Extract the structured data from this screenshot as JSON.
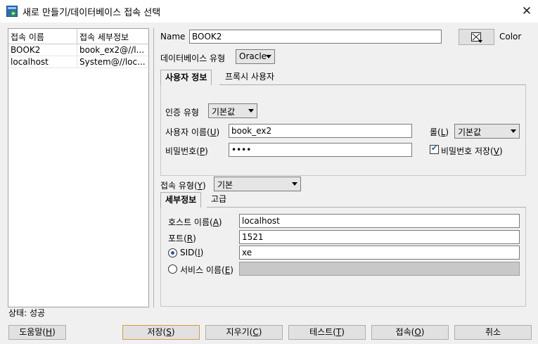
{
  "window": {
    "title": "새로 만들기/데이터베이스 접속 선택",
    "close_glyph": "✕"
  },
  "connections": {
    "headers": [
      "접속 이름",
      "접속 세부정보"
    ],
    "rows": [
      {
        "name": "BOOK2",
        "details": "book_ex2@//l..."
      },
      {
        "name": "localhost",
        "details": "System@//loc..."
      }
    ]
  },
  "status": "상태: 성공",
  "form": {
    "name_label": "Name",
    "name_value": "BOOK2",
    "color_label": "Color",
    "dbtype_label": "데이터베이스 유형",
    "dbtype_value": "Oracle",
    "tabs_main": [
      "사용자 정보",
      "프록시 사용자"
    ],
    "auth_label": "인증 유형",
    "auth_value": "기본값",
    "username_label": "사용자 이름(",
    "username_key": "U",
    "username_value": "book_ex2",
    "role_label": "롤(",
    "role_key": "L",
    "role_value": "기본값",
    "password_label": "비밀번호(",
    "password_key": "P",
    "password_value": "••••",
    "save_pw_label": "비밀번호 저장(",
    "save_pw_key": "V",
    "save_pw_checked": true,
    "conn_type_label": "접속 유형(",
    "conn_type_key": "Y",
    "conn_type_value": "기본",
    "tabs_conn": [
      "세부정보",
      "고급"
    ],
    "host_label": "호스트 이름(",
    "host_key": "A",
    "host_value": "localhost",
    "port_label": "포트(",
    "port_key": "R",
    "port_value": "1521",
    "sid_label": "SID(",
    "sid_key": "I",
    "sid_value": "xe",
    "sid_selected": true,
    "service_label": "서비스 이름(",
    "service_key": "E",
    "service_value": ""
  },
  "buttons": {
    "help": {
      "label": "도움말(",
      "key": "H"
    },
    "save": {
      "label": "저장(",
      "key": "S"
    },
    "clear": {
      "label": "지우기(",
      "key": "C"
    },
    "test": {
      "label": "테스트(",
      "key": "T"
    },
    "connect": {
      "label": "접속(",
      "key": "O"
    },
    "cancel": {
      "label": "취소"
    }
  }
}
